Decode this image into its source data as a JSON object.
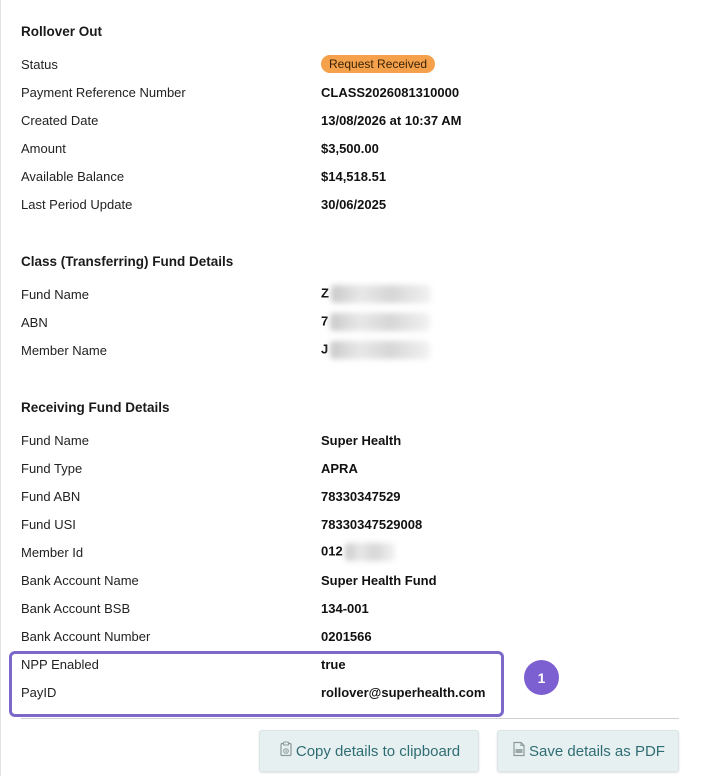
{
  "rollover": {
    "title": "Rollover Out",
    "status_label": "Status",
    "status_value": "Request Received",
    "rows": [
      {
        "label": "Payment Reference Number",
        "value": "CLASS2026081310000"
      },
      {
        "label": "Created Date",
        "value": "13/08/2026 at 10:37 AM"
      },
      {
        "label": "Amount",
        "value": "$3,500.00"
      },
      {
        "label": "Available Balance",
        "value": "$14,518.51"
      },
      {
        "label": "Last Period Update",
        "value": "30/06/2025"
      }
    ]
  },
  "transferring": {
    "title": "Class (Transferring) Fund Details",
    "rows": [
      {
        "label": "Fund Name",
        "value": "Z"
      },
      {
        "label": "ABN",
        "value": "7"
      },
      {
        "label": "Member Name",
        "value": "J"
      }
    ]
  },
  "receiving": {
    "title": "Receiving Fund Details",
    "rows": [
      {
        "label": "Fund Name",
        "value": "Super Health"
      },
      {
        "label": "Fund Type",
        "value": "APRA"
      },
      {
        "label": "Fund ABN",
        "value": "78330347529"
      },
      {
        "label": "Fund USI",
        "value": "78330347529008"
      },
      {
        "label": "Member Id",
        "value": "012"
      },
      {
        "label": "Bank Account Name",
        "value": "Super Health Fund"
      },
      {
        "label": "Bank Account BSB",
        "value": "134-001"
      },
      {
        "label": "Bank Account Number",
        "value": "0201566"
      },
      {
        "label": "NPP Enabled",
        "value": "true"
      },
      {
        "label": "PayID",
        "value": "rollover@superhealth.com"
      }
    ]
  },
  "step_marker": "1",
  "actions": {
    "copy_label": "Copy details to clipboard",
    "pdf_label": "Save details as PDF"
  },
  "colors": {
    "badge": "#f5a04a",
    "highlight": "#7b68c9",
    "step": "#7c5fd0",
    "button_bg": "#e7f0f0",
    "button_text": "#2f6d74"
  },
  "icons": {
    "copy": "clipboard-icon",
    "pdf": "pdf-file-icon"
  }
}
